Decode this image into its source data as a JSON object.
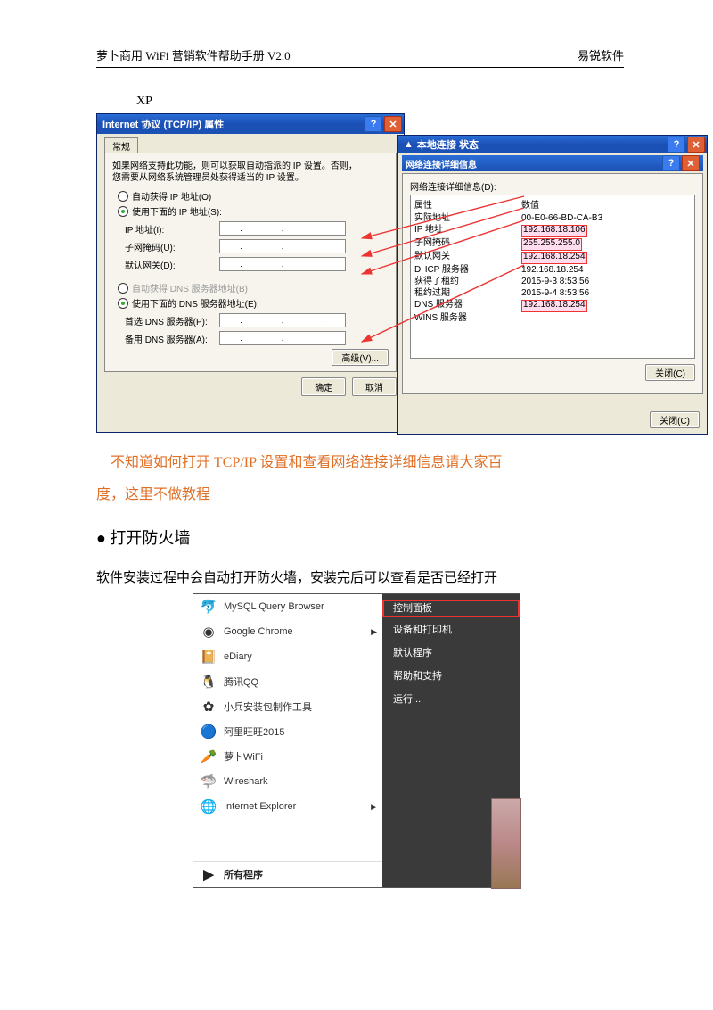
{
  "header": {
    "left": "萝卜商用 WiFi 营销软件帮助手册  V2.0",
    "right": "易锐软件"
  },
  "xp_label": "XP",
  "dlg_tcpip": {
    "title": "Internet 协议 (TCP/IP) 属性",
    "tab": "常规",
    "desc1": "如果网络支持此功能，则可以获取自动指派的 IP 设置。否则，",
    "desc2": "您需要从网络系统管理员处获得适当的 IP 设置。",
    "radio_auto_ip": "自动获得 IP 地址(O)",
    "radio_manual_ip": "使用下面的 IP 地址(S):",
    "ip_label": "IP 地址(I):",
    "mask_label": "子网掩码(U):",
    "gw_label": "默认网关(D):",
    "radio_auto_dns": "自动获得 DNS 服务器地址(B)",
    "radio_manual_dns": "使用下面的 DNS 服务器地址(E):",
    "dns1_label": "首选 DNS 服务器(P):",
    "dns2_label": "备用 DNS 服务器(A):",
    "adv_btn": "高级(V)...",
    "ok": "确定",
    "cancel": "取消"
  },
  "dlg_status": {
    "outer_title": "本地连接 状态",
    "inner_title": "网络连接详细信息",
    "details_label": "网络连接详细信息(D):",
    "col_prop": "属性",
    "col_val": "数值",
    "rows": {
      "mac_k": "实际地址",
      "mac_v": "00-E0-66-BD-CA-B3",
      "ip_k": "IP 地址",
      "ip_v": "192.168.18.106",
      "mask_k": "子网掩码",
      "mask_v": "255.255.255.0",
      "gw_k": "默认网关",
      "gw_v": "192.168.18.254",
      "dhcp_k": "DHCP 服务器",
      "dhcp_v": "192.168.18.254",
      "lease_k": "获得了租约",
      "lease_v": "2015-9-3 8:53:56",
      "exp_k": "租约过期",
      "exp_v": "2015-9-4 8:53:56",
      "dns_k": "DNS 服务器",
      "dns_v": "192.168.18.254",
      "wins_k": "WINS 服务器",
      "wins_v": ""
    },
    "close": "关闭(C)",
    "outer_close": "关闭(C)"
  },
  "note": {
    "prefix": "不知道如何",
    "link1": "打开 TCP/IP 设置",
    "mid": "和查看",
    "link2": "网络连接详细信息",
    "suffix1": "请大家百",
    "line2": "度，这里不做教程"
  },
  "bullet_heading": "打开防火墙",
  "plain_text": "软件安装过程中会自动打开防火墙，安装完后可以查看是否已经打开",
  "start_menu": {
    "left": {
      "mysql": "MySQL Query Browser",
      "chrome": "Google Chrome",
      "ediary": "eDiary",
      "qq": "腾讯QQ",
      "xb": "小兵安装包制作工具",
      "ww": "阿里旺旺2015",
      "lbwf": "萝卜WiFi",
      "ws": "Wireshark",
      "ie": "Internet Explorer",
      "all": "所有程序"
    },
    "right": {
      "cp": "控制面板",
      "dev": "设备和打印机",
      "def": "默认程序",
      "help": "帮助和支持",
      "run": "运行..."
    }
  }
}
